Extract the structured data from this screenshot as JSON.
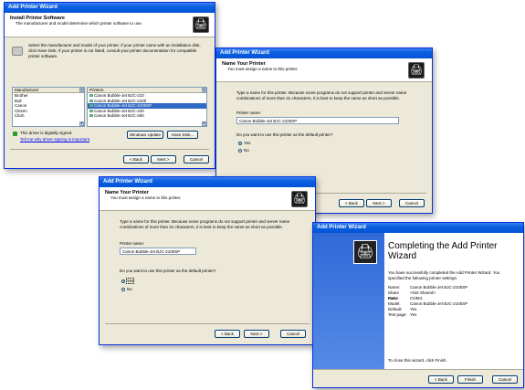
{
  "w1": {
    "title": "Add Printer Wizard",
    "header_title": "Install Printer Software",
    "header_sub": "The manufacturer and model determine which printer software to use.",
    "instructions": "Select the manufacturer and model of your printer. If your printer came with an installation disk, click Have Disk. If your printer is not listed, consult your printer documentation for compatible printer software.",
    "manufacturer_header": "Manufacturer",
    "manufacturers": [
      "Brother",
      "Bull",
      "Canon",
      "Citizen",
      "Citoh"
    ],
    "printers_header": "Printers",
    "printers": [
      "Canon Bubble-Jet BJC-210",
      "Canon Bubble-Jet BJC-2100",
      "Canon Bubble-Jet BJC-2100SP",
      "Canon Bubble-Jet BJC-240",
      "Canon Bubble-Jet BJC-250"
    ],
    "selected_printer_index": 2,
    "signed_text": "This driver is digitally signed.",
    "signing_link": "Tell me why driver signing is important",
    "windows_update": "Windows Update",
    "have_disk": "Have Disk...",
    "back": "< Back",
    "next": "Next >",
    "cancel": "Cancel"
  },
  "w2": {
    "title": "Add Printer Wizard",
    "header_title": "Name Your Printer",
    "header_sub": "You must assign a name to this printer.",
    "instructions": "Type a name for this printer. Because some programs do not support printer and server name combinations of more than 31 characters, it is best to keep the name as short as possible.",
    "name_label": "Printer name:",
    "name_value": "Canon Bubble-Jet BJC-2100SP",
    "default_question": "Do you want to use this printer as the default printer?",
    "yes": "Yes",
    "no": "No",
    "back": "< Back",
    "next": "Next >",
    "cancel": "Cancel"
  },
  "w3": {
    "title": "Add Printer Wizard",
    "header_title": "Name Your Printer",
    "header_sub": "You must assign a name to this printer.",
    "instructions": "Type a name for this printer. Because some programs do not support printer and server name combinations of more than 31 characters, it is best to keep the name as short as possible.",
    "name_label": "Printer name:",
    "name_value": "Canon Bubble-Jet BJC-2100SP",
    "default_question": "Do you want to use this printer as the default printer?",
    "yes": "Yes",
    "no": "No",
    "back": "< Back",
    "next": "Next >",
    "cancel": "Cancel"
  },
  "w4": {
    "title": "Add Printer Wizard",
    "heading": "Completing the Add Printer Wizard",
    "intro": "You have successfully completed the Add Printer Wizard. You specified the following printer settings:",
    "settings": [
      {
        "label": "Name:",
        "value": "Canon Bubble-Jet BJC-2100SP"
      },
      {
        "label": "Share name:",
        "value": "<Not Shared>"
      },
      {
        "label": "Port:",
        "value": "COM4:"
      },
      {
        "label": "Model:",
        "value": "Canon Bubble-Jet BJC-2100SP"
      },
      {
        "label": "Default:",
        "value": "Yes"
      },
      {
        "label": "Test page:",
        "value": "Yes"
      }
    ],
    "close_text": "To close this wizard, click Finish.",
    "back": "< Back",
    "finish": "Finish",
    "cancel": "Cancel"
  }
}
